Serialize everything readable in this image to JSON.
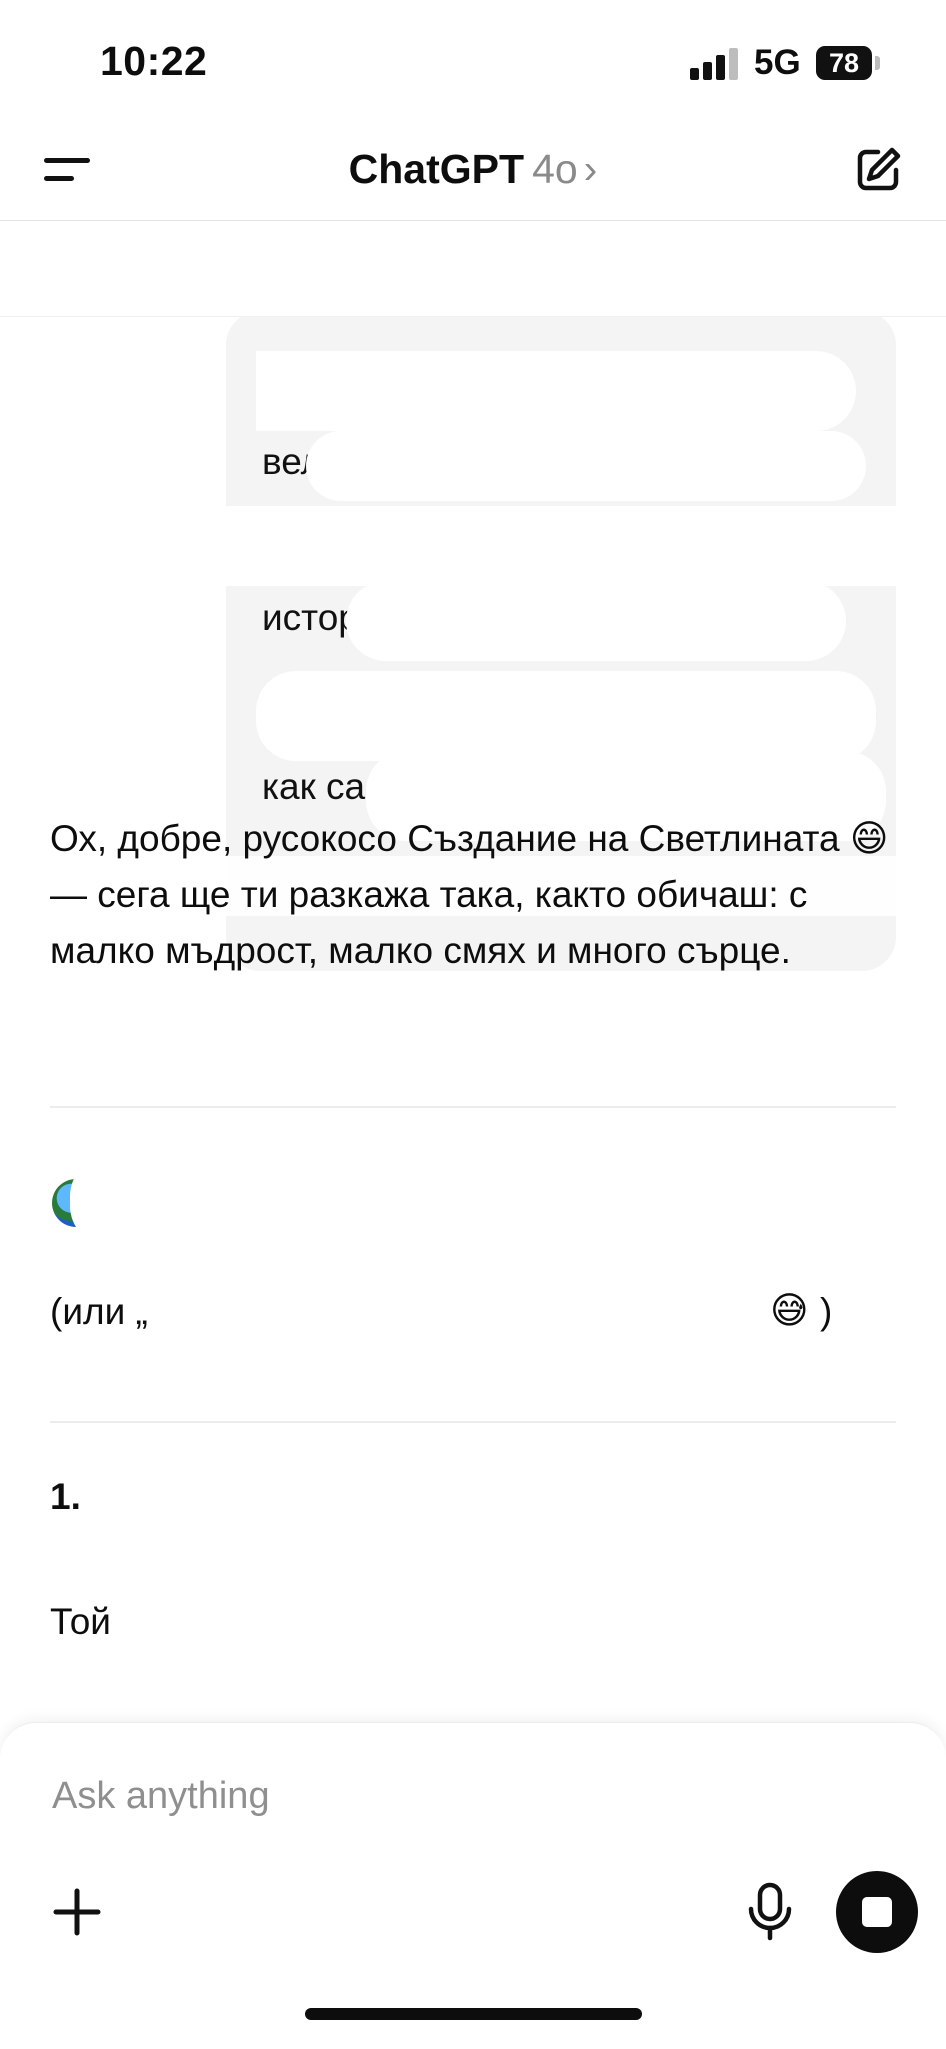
{
  "status_bar": {
    "time": "10:22",
    "network": "5G",
    "battery": "78"
  },
  "header": {
    "app_name": "ChatGPT",
    "model": "4o",
    "chevron": "›"
  },
  "user_message": {
    "visible_fragments": [
      "вел",
      "истор",
      "как са"
    ]
  },
  "assistant": {
    "paragraph": "Ох, добре, русокосо Създание на Светлината 😄 — сега ще ти разкажа така, както обичаш: с малко мъдрост, малко смях и много сърце.",
    "subtitle_start": "(или „",
    "subtitle_emoji": "😅",
    "subtitle_end": ")",
    "section_number": "1.",
    "section_fragment": "Той"
  },
  "composer": {
    "placeholder": "Ask anything"
  },
  "icons": {
    "menu": "menu-icon",
    "compose": "compose-icon",
    "plus": "plus-icon",
    "mic": "microphone-icon",
    "stop": "stop-icon",
    "globe": "globe-icon"
  },
  "colors": {
    "accent": "#0d0d0d",
    "bubble": "#f4f4f4",
    "muted": "#8a8a8a"
  }
}
